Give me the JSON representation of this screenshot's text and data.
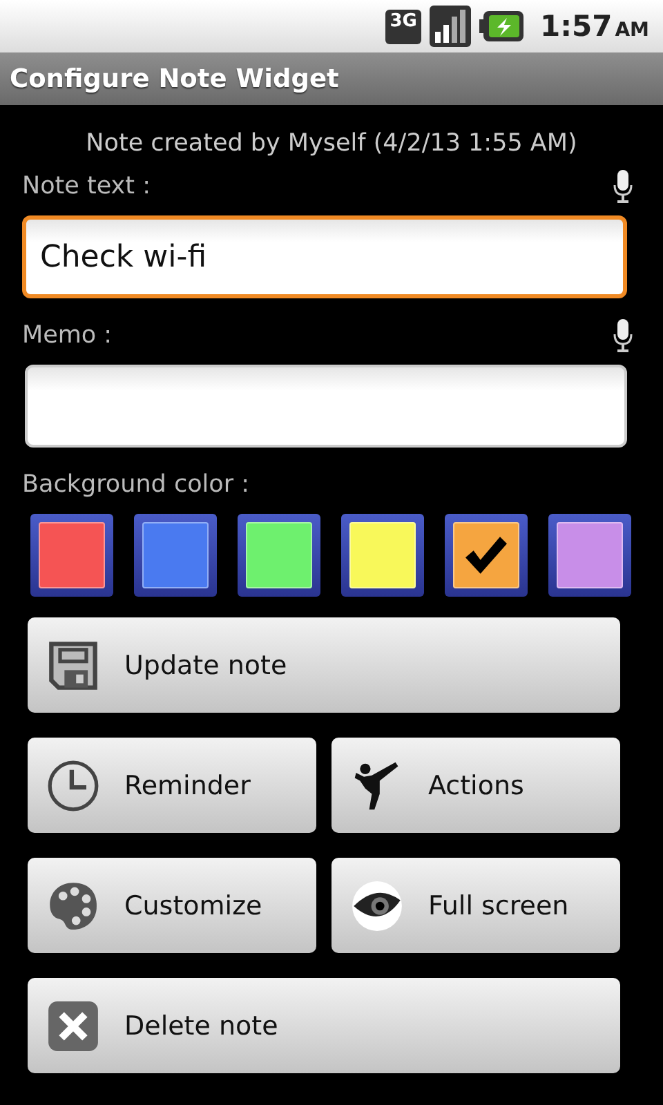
{
  "status_bar": {
    "network": "3G",
    "time": "1:57",
    "meridiem": "AM"
  },
  "title_bar": {
    "title": "Configure Note Widget"
  },
  "caption": "Note created by Myself (4/2/13 1:55 AM)",
  "note_text": {
    "label": "Note text :",
    "value": "Check wi-fi",
    "focused": true
  },
  "memo": {
    "label": "Memo :",
    "focused": false
  },
  "background_color": {
    "label": "Background color :",
    "swatches": [
      {
        "color": "#f55454",
        "selected": false
      },
      {
        "color": "#4a7af0",
        "selected": false
      },
      {
        "color": "#6ef06e",
        "selected": false
      },
      {
        "color": "#f8f85a",
        "selected": false
      },
      {
        "color": "#f5a540",
        "selected": true
      },
      {
        "color": "#c88ee8",
        "selected": false
      }
    ]
  },
  "buttons": [
    {
      "label": "Update note",
      "wide": true
    },
    {
      "label": "Reminder",
      "wide": false
    },
    {
      "label": "Actions",
      "wide": false
    },
    {
      "label": "Customize",
      "wide": false
    },
    {
      "label": "Full screen",
      "wide": false
    },
    {
      "label": "Delete note",
      "wide": true
    }
  ]
}
